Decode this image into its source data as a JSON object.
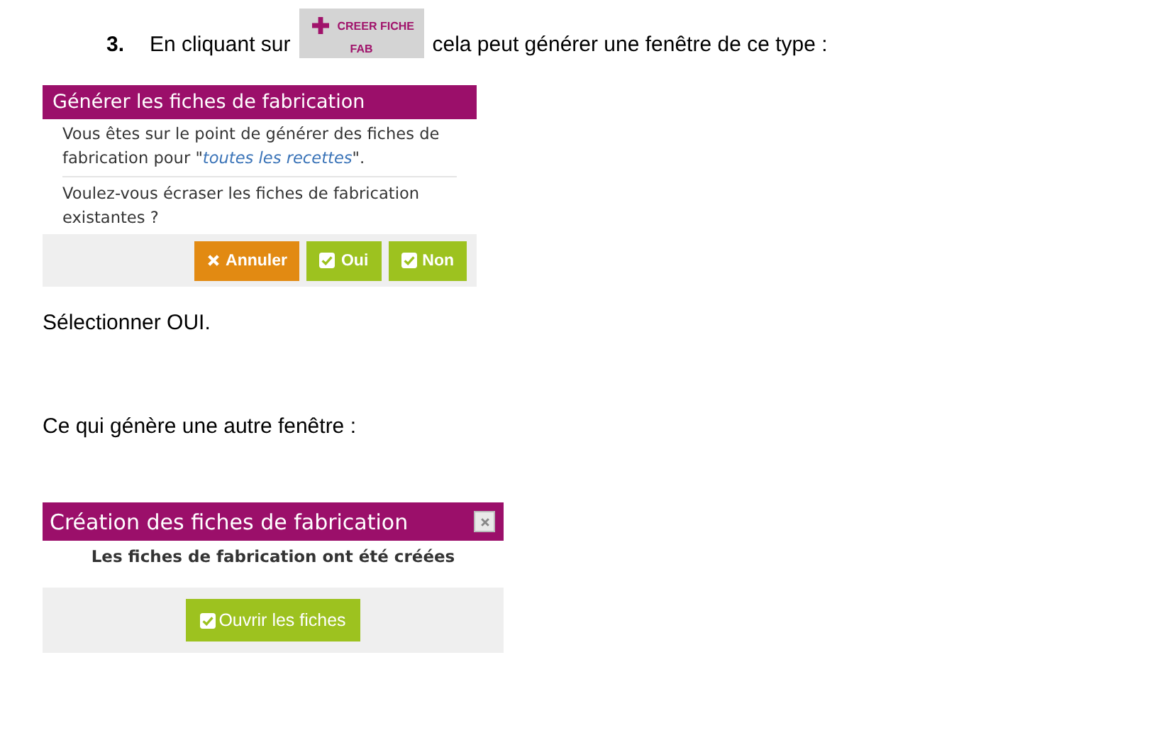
{
  "step": {
    "number": "3.",
    "text_before": "En cliquant sur",
    "button": {
      "label_line1": "CREER FICHE",
      "label_line2": "FAB"
    },
    "text_after": "cela peut générer une fenêtre de ce type :"
  },
  "dialog_confirm": {
    "title": "Générer les fiches de fabrication",
    "message": "Vous êtes sur le point de générer des fiches de fabrication pour \"*toutes les recettes*\".",
    "question": "Voulez-vous écraser les fiches de fabrication existantes ?",
    "buttons": [
      {
        "label": "Annuler",
        "kind": "cancel"
      },
      {
        "label": "Oui",
        "kind": "confirm"
      },
      {
        "label": "Non",
        "kind": "confirm"
      }
    ]
  },
  "instruction": "Sélectionner OUI.",
  "intro": "Ce qui génère une autre fenêtre :",
  "dialog_result": {
    "title": "Création des fiches de fabrication",
    "message": "Les fiches de fabrication ont été créées",
    "buttons": [
      {
        "label": "Ouvrir les fiches",
        "kind": "confirm"
      }
    ]
  }
}
